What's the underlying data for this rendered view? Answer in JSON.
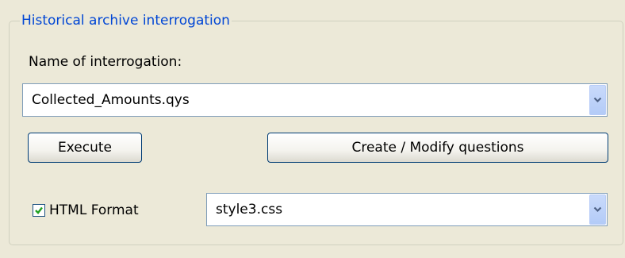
{
  "group": {
    "title": "Historical archive interrogation"
  },
  "interrogation": {
    "label": "Name of interrogation:",
    "selected_value": "Collected_Amounts.qys"
  },
  "buttons": {
    "execute_label": "Execute",
    "create_modify_label": "Create / Modify questions"
  },
  "html_format": {
    "label": "HTML Format",
    "checked": true
  },
  "stylesheet": {
    "selected_value": "style3.css"
  },
  "icons": {
    "dropdown": "chevron-down-icon",
    "checkmark": "checkmark-icon"
  },
  "colors": {
    "window_background": "#ECE9D8",
    "group_title": "#0046D5",
    "checkmark": "#21A121",
    "dropdown_arrow": "#4D6185",
    "combo_border": "#7F9DB9",
    "button_border": "#003C74"
  }
}
